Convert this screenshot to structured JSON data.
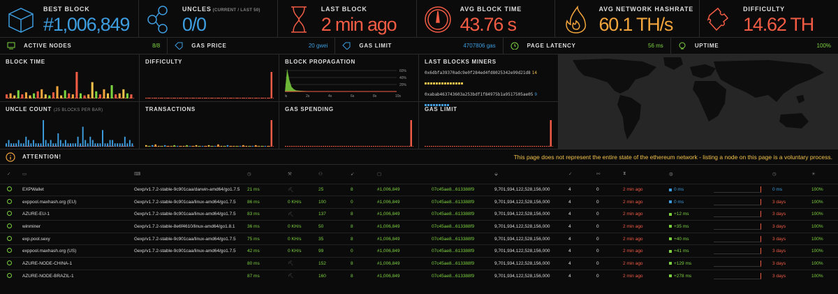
{
  "colors": {
    "green": "#7dd33f",
    "blue": "#3d9ddf",
    "red": "#f25c45",
    "orange": "#f2a53c",
    "yellow": "#f3c24b",
    "label": "#dddddd"
  },
  "stats": [
    {
      "label": "Best Block",
      "sub": "",
      "value": "#1,006,849",
      "color": "#3d9ddf",
      "icon": "cube-icon"
    },
    {
      "label": "Uncles",
      "sub": "(CURRENT / LAST 50)",
      "value": "0/0",
      "color": "#3d9ddf",
      "icon": "uncles-icon"
    },
    {
      "label": "Last Block",
      "sub": "",
      "value": "2 min ago",
      "color": "#f25c45",
      "icon": "hourglass-icon"
    },
    {
      "label": "Avg Block Time",
      "sub": "",
      "value": "43.76 s",
      "color": "#f25c45",
      "icon": "gauge-icon"
    },
    {
      "label": "Avg Network Hashrate",
      "sub": "",
      "value": "60.1 TH/s",
      "color": "#f2a53c",
      "icon": "fire-icon"
    },
    {
      "label": "Difficulty",
      "sub": "",
      "value": "14.62 TH",
      "color": "#f25c45",
      "icon": "puzzle-icon"
    }
  ],
  "substats": [
    {
      "label": "Active Nodes",
      "value": "8/8",
      "icon": "monitor-icon"
    },
    {
      "label": "Gas Price",
      "value": "20 gwei",
      "icon": "tag-icon",
      "valueColor": "#3d9ddf"
    },
    {
      "label": "Gas Limit",
      "value": "4707806 gas",
      "icon": "tag-icon",
      "valueColor": "#3d9ddf"
    },
    {
      "label": "Page Latency",
      "value": "56 ms",
      "icon": "latency-icon"
    },
    {
      "label": "Uptime",
      "value": "100%",
      "icon": "bulb-icon"
    }
  ],
  "charts": {
    "block_time": {
      "title": "Block Time"
    },
    "difficulty": {
      "title": "Difficulty"
    },
    "block_propagation": {
      "title": "Block Propagation",
      "yticks": [
        "60%",
        "40%",
        "20%"
      ],
      "xticks": [
        "0s",
        "2s",
        "4s",
        "6s",
        "8s",
        "10s"
      ]
    },
    "last_blocks_miners": {
      "title": "Last Blocks Miners",
      "miners": [
        {
          "address": "0x6dbfa39370adc9e0f284ed4fd8025342e99d21d8",
          "count": "14",
          "color": "#f3c24b"
        },
        {
          "address": "0xabab463743603a253bdf1f84975b1a9517505ae05",
          "count": "9",
          "color": "#3d9ddf"
        }
      ]
    },
    "uncle_count": {
      "title": "Uncle Count",
      "sub": "(25 BLOCKS PER BAR)"
    },
    "transactions": {
      "title": "Transactions"
    },
    "gas_spending": {
      "title": "Gas Spending"
    },
    "gas_limit": {
      "title": "Gas Limit"
    }
  },
  "chart_data": [
    {
      "type": "bar",
      "title": "Block Time",
      "values": [
        4,
        5,
        3,
        8,
        4,
        6,
        3,
        5,
        7,
        9,
        4,
        3,
        6,
        12,
        3,
        8,
        5,
        4,
        26,
        5,
        3,
        4,
        16,
        7,
        4,
        9,
        5,
        13,
        4,
        5,
        9,
        5,
        4
      ],
      "colors_cycle": [
        "#f25c45",
        "#f2a53c",
        "#f3c24b",
        "#7dd33f"
      ]
    },
    {
      "type": "bar",
      "title": "Difficulty",
      "values": [
        1,
        1,
        1,
        1,
        1,
        1,
        1,
        1,
        1,
        1,
        1,
        1,
        1,
        1,
        1,
        1,
        1,
        1,
        1,
        1,
        1,
        1,
        1,
        1,
        1,
        1,
        1,
        1,
        1,
        1,
        1,
        1,
        1,
        1,
        1,
        1,
        1,
        1,
        1,
        1,
        100
      ]
    },
    {
      "type": "line",
      "title": "Block Propagation",
      "x": [
        0,
        0.2,
        0.4,
        0.6,
        0.8,
        1,
        1.5,
        2,
        3,
        4,
        6,
        8,
        10
      ],
      "y": [
        0,
        60,
        30,
        12,
        6,
        3,
        1.5,
        1,
        0.5,
        0.2,
        0.1,
        0,
        0
      ],
      "ylim": [
        0,
        70
      ],
      "xlim": [
        0,
        10
      ]
    },
    {
      "type": "bar",
      "title": "Uncle Count",
      "values": [
        1,
        2,
        1,
        1,
        1,
        2,
        1,
        1,
        3,
        2,
        1,
        2,
        1,
        1,
        1,
        8,
        2,
        1,
        2,
        1,
        1,
        4,
        2,
        1,
        2,
        1,
        1,
        1,
        1,
        3,
        1,
        6,
        2,
        1,
        3,
        2,
        1,
        1,
        1,
        5,
        1,
        1,
        2,
        2,
        1,
        1,
        1,
        1,
        3,
        1,
        2,
        1
      ]
    },
    {
      "type": "bar",
      "title": "Transactions",
      "values": [
        2,
        1,
        2,
        3,
        1,
        1,
        2,
        1,
        1,
        2,
        1,
        1,
        1,
        2,
        1,
        1,
        2,
        1,
        1,
        1,
        2,
        1,
        1,
        3,
        1,
        1,
        2,
        1,
        1,
        1,
        1,
        2,
        1,
        1,
        1,
        2,
        1,
        1,
        1,
        1,
        35
      ]
    },
    {
      "type": "bar",
      "title": "Gas Spending",
      "values": [
        0,
        0,
        0,
        0,
        0,
        0,
        0,
        0,
        0,
        0,
        0,
        0,
        0,
        0,
        0,
        0,
        0,
        0,
        0,
        0,
        0,
        0,
        0,
        0,
        0,
        0,
        0,
        0,
        0,
        0,
        0,
        0,
        0,
        0,
        0,
        0,
        0,
        0,
        0,
        0,
        100
      ]
    },
    {
      "type": "bar",
      "title": "Gas Limit",
      "values": [
        0,
        0,
        0,
        0,
        0,
        0,
        0,
        0,
        0,
        0,
        0,
        0,
        0,
        0,
        0,
        0,
        0,
        0,
        0,
        0,
        0,
        0,
        0,
        0,
        0,
        0,
        0,
        0,
        0,
        0,
        0,
        0,
        0,
        0,
        0,
        0,
        0,
        0,
        0,
        0,
        100
      ]
    }
  ],
  "attention": {
    "label": "Attention!",
    "message": "This page does not represent the entire state of the ethereum network - listing a node on this page is a voluntary process."
  },
  "table": {
    "headers": [
      "check-icon",
      "monitor-icon",
      "laptop-icon",
      "clock-icon",
      "pickaxe-icon",
      "peers-icon",
      "pending-icon",
      "cube-icon",
      "",
      "tag-icon",
      "",
      "check-icon",
      "uncles-icon",
      "hourglass-icon",
      "gauge-icon",
      "",
      "clock-icon",
      "bulb-icon"
    ],
    "rows": [
      {
        "name": "EXPWallet",
        "client": "Gexp/v1.7.2-stable-9c901caa/darwin-amd64/go1.7.5",
        "latency": "21 ms",
        "hashrate": "",
        "mining": false,
        "peers": "25",
        "pending": "8",
        "block": "#1,006,849",
        "hash": "07c45ae8...613388f9",
        "difficulty": "9,701,934,122,528,156,000",
        "txs": "4",
        "uncles": "0",
        "last": "2 min ago",
        "prop": "0 ms",
        "propColor": "#3d9ddf",
        "avg": "0 ms",
        "avgColor": "#3d9ddf",
        "uptime": "100%"
      },
      {
        "name": "exppool.maxhash.org (EU)",
        "client": "Gexp/v1.7.2-stable-9c901caa/linux-amd64/go1.7.5",
        "latency": "86 ms",
        "hashrate": "0 KH/s",
        "mining": false,
        "peers": "100",
        "pending": "0",
        "block": "#1,006,849",
        "hash": "07c45ae8...613388f9",
        "difficulty": "9,701,934,122,528,156,000",
        "txs": "4",
        "uncles": "0",
        "last": "2 min ago",
        "prop": "0 ms",
        "propColor": "#3d9ddf",
        "avg": "3 days",
        "avgColor": "#f25c45",
        "uptime": "100%"
      },
      {
        "name": "AZURE-EU-1",
        "client": "Gexp/v1.7.2-stable-9c901caa/linux-amd64/go1.7.5",
        "latency": "83 ms",
        "hashrate": "",
        "mining": false,
        "peers": "137",
        "pending": "8",
        "block": "#1,006,849",
        "hash": "07c45ae8...613388f9",
        "difficulty": "9,701,934,122,528,156,000",
        "txs": "4",
        "uncles": "0",
        "last": "2 min ago",
        "prop": "+12 ms",
        "propColor": "#7dd33f",
        "avg": "3 days",
        "avgColor": "#f25c45",
        "uptime": "100%"
      },
      {
        "name": "winminer",
        "client": "Gexp/v1.7.2-stable-8e6f4610/linux-amd64/go1.8.1",
        "latency": "36 ms",
        "hashrate": "0 KH/s",
        "mining": false,
        "peers": "50",
        "pending": "8",
        "block": "#1,006,849",
        "hash": "07c45ae8...613388f9",
        "difficulty": "9,701,934,122,528,156,000",
        "txs": "4",
        "uncles": "0",
        "last": "2 min ago",
        "prop": "+35 ms",
        "propColor": "#7dd33f",
        "avg": "3 days",
        "avgColor": "#f25c45",
        "uptime": "100%"
      },
      {
        "name": "exp.pool.sexy",
        "client": "Gexp/v1.7.2-stable-9c901caa/linux-amd64/go1.7.5",
        "latency": "75 ms",
        "hashrate": "0 KH/s",
        "mining": false,
        "peers": "35",
        "pending": "8",
        "block": "#1,006,849",
        "hash": "07c45ae8...613388f9",
        "difficulty": "9,701,934,122,528,156,000",
        "txs": "4",
        "uncles": "0",
        "last": "2 min ago",
        "prop": "+40 ms",
        "propColor": "#7dd33f",
        "avg": "3 days",
        "avgColor": "#f25c45",
        "uptime": "100%"
      },
      {
        "name": "exppool.maxhash.org (US)",
        "client": "Gexp/v1.7.2-stable-9c901caa/linux-amd64/go1.7.5",
        "latency": "42 ms",
        "hashrate": "0 KH/s",
        "mining": false,
        "peers": "99",
        "pending": "0",
        "block": "#1,006,849",
        "hash": "07c45ae8...613388f9",
        "difficulty": "9,701,934,122,528,156,000",
        "txs": "4",
        "uncles": "0",
        "last": "2 min ago",
        "prop": "+41 ms",
        "propColor": "#7dd33f",
        "avg": "3 days",
        "avgColor": "#f25c45",
        "uptime": "100%"
      },
      {
        "name": "AZURE-NODE-CHINA-1",
        "client": "",
        "latency": "80 ms",
        "hashrate": "",
        "mining": false,
        "peers": "152",
        "pending": "8",
        "block": "#1,006,849",
        "hash": "07c45ae8...613388f9",
        "difficulty": "9,701,934,122,528,156,000",
        "txs": "4",
        "uncles": "0",
        "last": "2 min ago",
        "prop": "+129 ms",
        "propColor": "#7dd33f",
        "avg": "3 days",
        "avgColor": "#f25c45",
        "uptime": "100%"
      },
      {
        "name": "AZURE-NODE-BRAZIL-1",
        "client": "",
        "latency": "87 ms",
        "hashrate": "",
        "mining": false,
        "peers": "160",
        "pending": "8",
        "block": "#1,006,849",
        "hash": "07c45ae8...613388f9",
        "difficulty": "9,701,934,122,528,156,000",
        "txs": "4",
        "uncles": "0",
        "last": "2 min ago",
        "prop": "+278 ms",
        "propColor": "#7dd33f",
        "avg": "3 days",
        "avgColor": "#f25c45",
        "uptime": "100%"
      }
    ]
  }
}
